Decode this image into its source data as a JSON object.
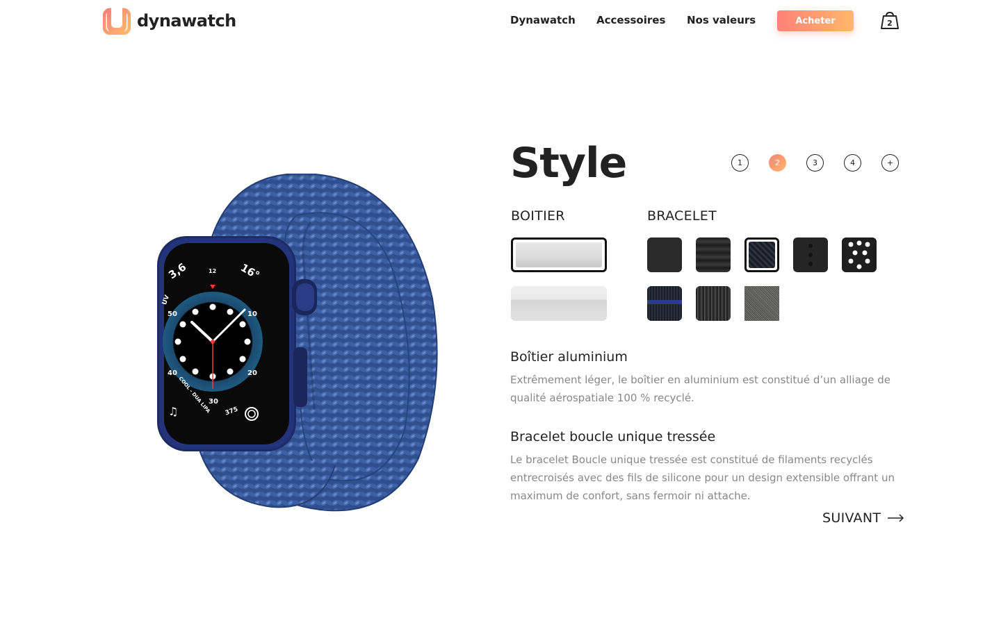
{
  "header": {
    "brand": "dynawatch",
    "nav": [
      "Dynawatch",
      "Accessoires",
      "Nos valeurs"
    ],
    "buy_label": "Acheter",
    "cart_count": "2"
  },
  "configurator": {
    "title": "Style",
    "steps": [
      {
        "label": "1",
        "active": false
      },
      {
        "label": "2",
        "active": true
      },
      {
        "label": "3",
        "active": false
      },
      {
        "label": "4",
        "active": false
      },
      {
        "label": "+",
        "active": false
      }
    ],
    "case_label": "BOITIER",
    "band_label": "BRACELET",
    "case_options": [
      "aluminium-silver (selected)",
      "aluminium-light"
    ],
    "band_options": [
      "black-sport",
      "black-ribbed",
      "black-braided (selected)",
      "black-pins",
      "black-perforated",
      "navy-loop",
      "grey-loop",
      "steel-mesh"
    ]
  },
  "details": {
    "case_title": "Boîtier aluminium",
    "case_text": "Extrêmement léger, le boîtier en aluminium est constitué d’un alliage de qualité aérospatiale 100 % recyclé.",
    "band_title": "Bracelet boucle unique tressée",
    "band_text": "Le bracelet Boucle unique tressée est constitué de filaments recyclés entrecroisés avec des fils de silicone pour un design extensible offrant un maximum de confort, sans fermoir ni attache."
  },
  "next_label": "SUIVANT",
  "watch_face": {
    "complications": [
      "3,6",
      "UV",
      "16°",
      "12",
      "50",
      "10",
      "40",
      "20",
      "30",
      "375",
      "COOL - DUA LIPA"
    ]
  },
  "colors": {
    "accent_start": "#ff8177",
    "accent_end": "#ffb86b",
    "band_blue": "#3b5a9a",
    "case_blue": "#1e2c66"
  }
}
